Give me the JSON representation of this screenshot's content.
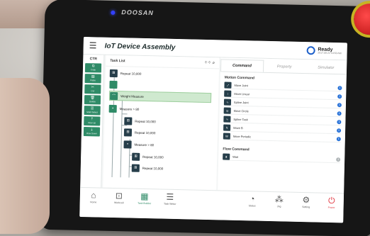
{
  "device": {
    "brand": "DOOSAN"
  },
  "app": {
    "title": "IoT Device Assembly",
    "status": {
      "label": "Ready",
      "date": "2017.08.21 10:50 AM"
    }
  },
  "ctr_panel": {
    "header": "CTR",
    "buttons": [
      {
        "label": "Copy",
        "icon": "copy-icon",
        "glyph": "⧉"
      },
      {
        "label": "Paste",
        "icon": "paste-icon",
        "glyph": "▤"
      },
      {
        "label": "Cut",
        "icon": "cut-icon",
        "glyph": "✂"
      },
      {
        "label": "Delete",
        "icon": "delete-icon",
        "glyph": "🗑"
      },
      {
        "label": "Multi Select",
        "icon": "multi-select-icon",
        "glyph": "☰"
      },
      {
        "label": "Row Up",
        "icon": "row-up-icon",
        "glyph": "⇡"
      },
      {
        "label": "Row Down",
        "icon": "row-down-icon",
        "glyph": "⇣"
      }
    ]
  },
  "task_list": {
    "header": "Task List",
    "rows": [
      {
        "label": "Repeat 10,000",
        "icon": "repeat-icon",
        "glyph": "⊞"
      },
      {
        "label": "",
        "icon": "step-icon",
        "glyph": ""
      },
      {
        "label": "Weight Measure",
        "icon": "weight-measure-icon",
        "glyph": "⌒"
      },
      {
        "label": "Measure > 80",
        "icon": "condition-icon",
        "glyph": "▪"
      },
      {
        "label": "Repeat 10,000",
        "icon": "repeat-icon",
        "glyph": "⊞"
      },
      {
        "label": "Repeat 10,000",
        "icon": "repeat-icon",
        "glyph": "⊞"
      },
      {
        "label": "Measure > 80",
        "icon": "condition-icon",
        "glyph": "▪"
      },
      {
        "label": "Repeat 10,000",
        "icon": "repeat-icon",
        "glyph": "⊞"
      },
      {
        "label": "Repeat 10,000",
        "icon": "repeat-icon",
        "glyph": "⊞"
      }
    ]
  },
  "right_panel": {
    "tabs": [
      "Command",
      "Property",
      "Simulator"
    ],
    "motion_header": "Motion Command",
    "motion_commands": [
      {
        "label": "Move Joint",
        "icon": "move-joint-icon",
        "glyph": "⤢"
      },
      {
        "label": "Move Linear",
        "icon": "move-linear-icon",
        "glyph": "↕"
      },
      {
        "label": "Spline Joint",
        "icon": "spline-joint-icon",
        "glyph": "∿"
      },
      {
        "label": "Move Circle",
        "icon": "move-circle-icon",
        "glyph": "◎"
      },
      {
        "label": "Spline Task",
        "icon": "spline-task-icon",
        "glyph": "∿"
      },
      {
        "label": "Move B",
        "icon": "move-b-icon",
        "glyph": "↯"
      },
      {
        "label": "Move Periodic",
        "icon": "move-periodic-icon",
        "glyph": "W"
      }
    ],
    "flow_header": "Flow Command",
    "flow_commands": [
      {
        "label": "Wait",
        "icon": "wait-icon",
        "glyph": "⧗"
      }
    ]
  },
  "bottom_nav": [
    {
      "label": "Home",
      "icon": "home-icon",
      "glyph": "⌂"
    },
    {
      "label": "Workcell",
      "icon": "workcell-icon",
      "glyph": "⊡"
    },
    {
      "label": "Task Builder",
      "icon": "task-builder-icon",
      "glyph": "▦"
    },
    {
      "label": "Task Writer",
      "icon": "task-writer-icon",
      "glyph": "☰"
    },
    {
      "label": "Status",
      "icon": "status-icon",
      "glyph": "◔"
    },
    {
      "label": "Jog",
      "icon": "jog-icon",
      "glyph": "⁂"
    },
    {
      "label": "Setting",
      "icon": "setting-icon",
      "glyph": "⚙"
    },
    {
      "label": "Power",
      "icon": "power-icon",
      "glyph": "⏻"
    }
  ],
  "colors": {
    "accent": "#2f8b67",
    "navy": "#263e4a",
    "info": "#2a73d8",
    "power": "#e0323c",
    "estop": "#d12020"
  }
}
